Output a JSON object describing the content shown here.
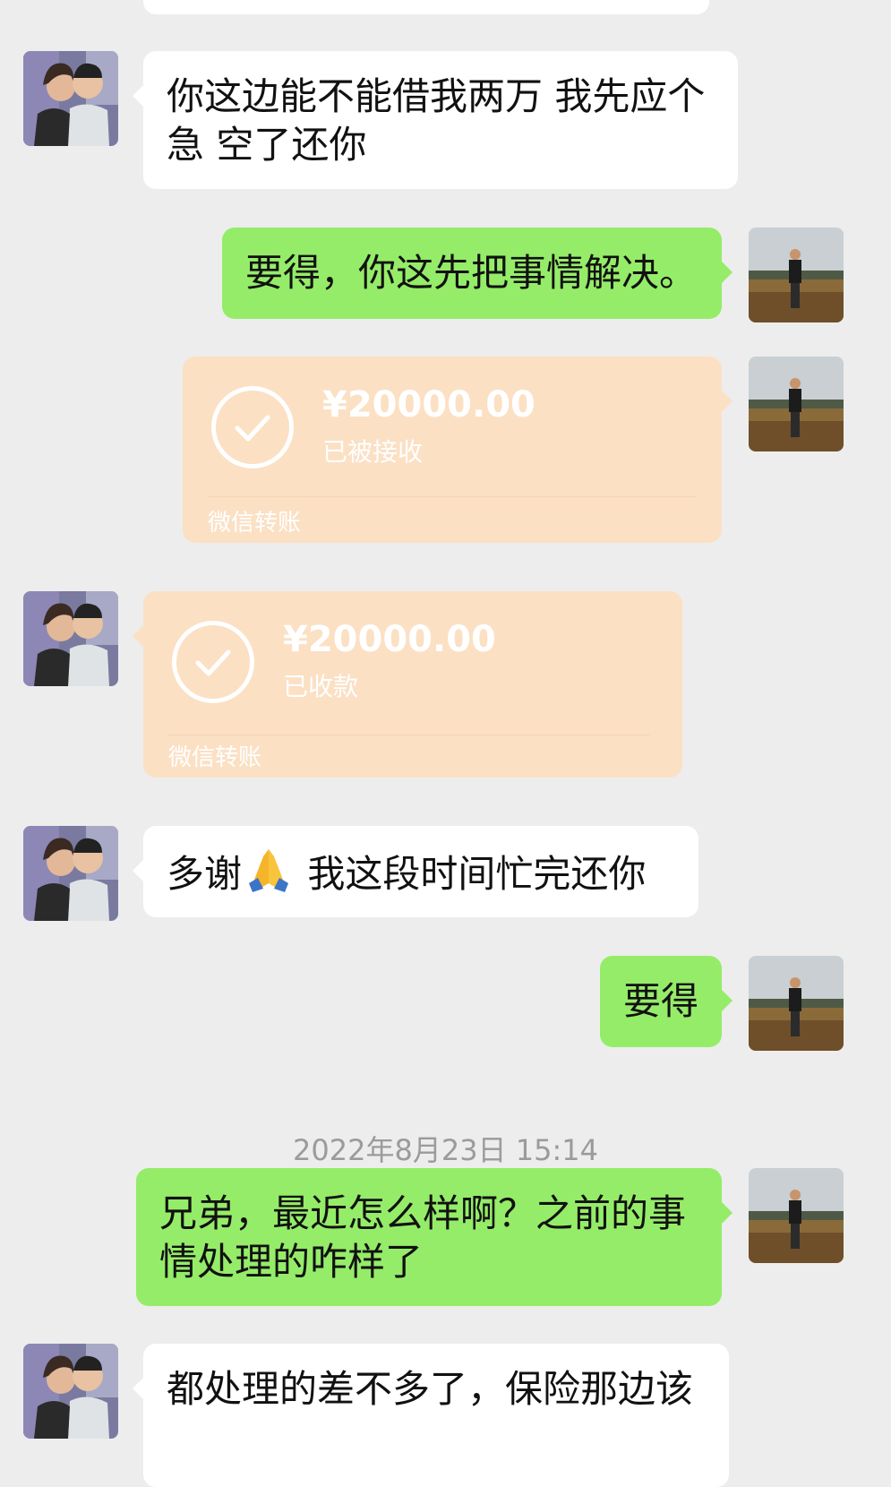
{
  "colors": {
    "background": "#ededed",
    "incoming_bubble": "#ffffff",
    "outgoing_bubble": "#95ec69",
    "transfer_card": "#fbe0c4",
    "timestamp_text": "#9b9b9b"
  },
  "icons": {
    "friend_avatar": "friend-couple-photo",
    "self_avatar": "self-field-photo",
    "transfer_check": "check-circle-icon"
  },
  "messages": {
    "m1": "你这边能不能借我两万 我先应个急 空了还你",
    "m2": "要得，你这先把事情解决。",
    "t1": {
      "amount": "¥20000.00",
      "status": "已被接收",
      "brand": "微信转账"
    },
    "t2": {
      "amount": "¥20000.00",
      "status": "已收款",
      "brand": "微信转账"
    },
    "m3_a": "多谢",
    "m3_b": " 我这段时间忙完还你",
    "m4": "要得",
    "timestamp": "2022年8月23日 15:14",
    "m5": "兄弟，最近怎么样啊？之前的事情处理的咋样了",
    "m6": "都处理的差不多了，保险那边该"
  }
}
